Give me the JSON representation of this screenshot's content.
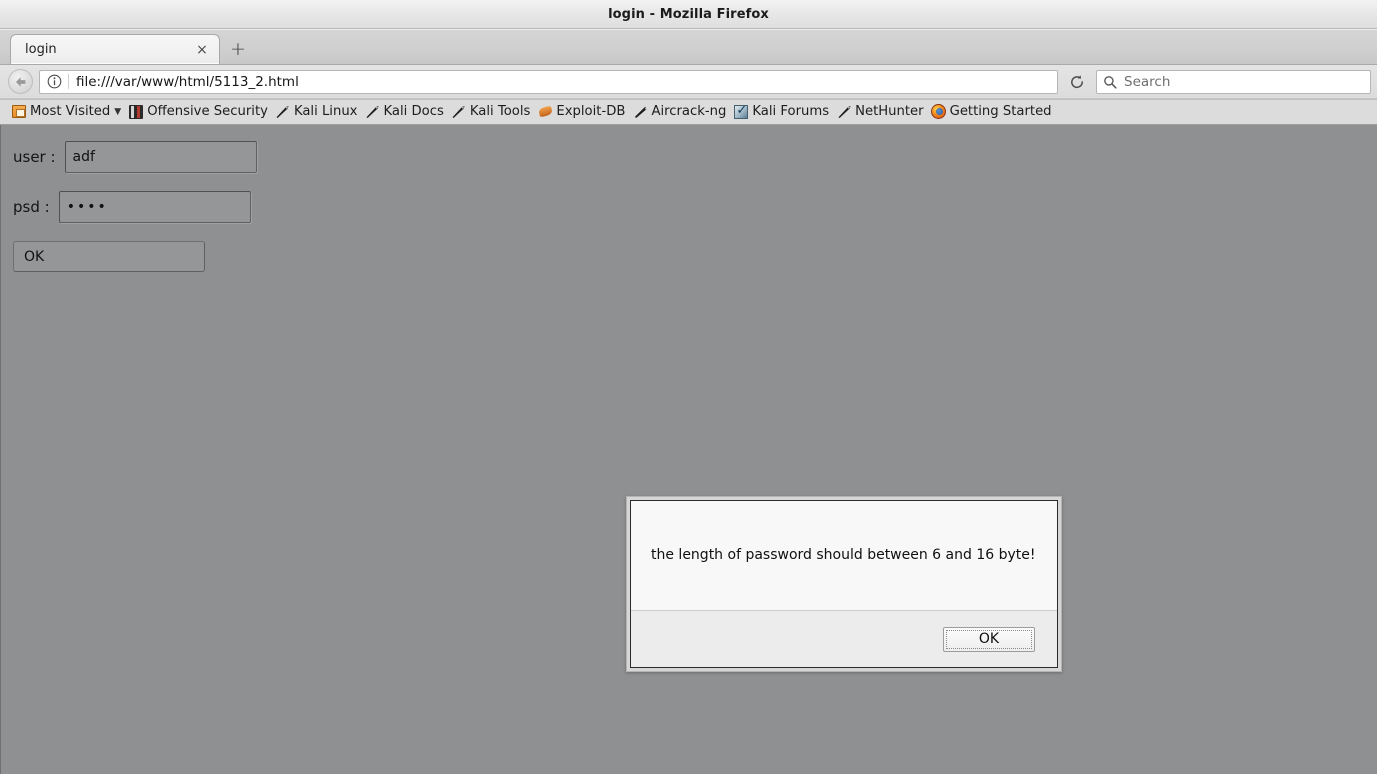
{
  "window": {
    "title": "login - Mozilla Firefox"
  },
  "tabs": {
    "items": [
      {
        "label": "login",
        "close_label": "×"
      }
    ],
    "new_tab_label": "+"
  },
  "navbar": {
    "back_icon": "back-arrow-icon",
    "identity_icon": "info-icon",
    "url": "file:///var/www/html/5113_2.html",
    "reload_label": "↻",
    "search_placeholder": "Search",
    "search_icon": "search-icon"
  },
  "bookmarks": [
    {
      "label": "Most Visited",
      "icon": "most-visited-icon",
      "has_caret": true
    },
    {
      "label": "Offensive Security",
      "icon": "offensive-security-icon",
      "has_caret": false
    },
    {
      "label": "Kali Linux",
      "icon": "dragon-icon",
      "has_caret": false
    },
    {
      "label": "Kali Docs",
      "icon": "dragon-icon",
      "has_caret": false
    },
    {
      "label": "Kali Tools",
      "icon": "dragon-icon",
      "has_caret": false
    },
    {
      "label": "Exploit-DB",
      "icon": "exploit-db-icon",
      "has_caret": false
    },
    {
      "label": "Aircrack-ng",
      "icon": "dragon-icon",
      "has_caret": false
    },
    {
      "label": "Kali Forums",
      "icon": "kali-forums-icon",
      "has_caret": false
    },
    {
      "label": "NetHunter",
      "icon": "dragon-icon",
      "has_caret": false
    },
    {
      "label": "Getting Started",
      "icon": "firefox-icon",
      "has_caret": false
    }
  ],
  "page": {
    "user_label": "user :",
    "user_value": "adf",
    "user_placeholder": "",
    "psd_label": "psd :",
    "psd_value": "••••",
    "psd_placeholder": "",
    "submit_label": "OK"
  },
  "dialog": {
    "message": "the length of password should between 6 and 16 byte!",
    "ok_label": "OK"
  },
  "colors": {
    "page_background": "#8f9092",
    "chrome_background": "#dcdcdc",
    "dialog_background": "#f8f8f8",
    "dialog_footer": "#ececec"
  }
}
